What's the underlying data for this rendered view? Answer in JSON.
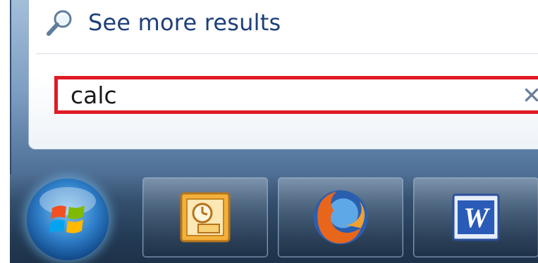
{
  "start_menu": {
    "see_more_label": "See more results",
    "search": {
      "value": "calc",
      "clear_glyph": "×",
      "highlight_color": "#e01b24"
    }
  },
  "taskbar": {
    "start_button_icon": "windows-orb-icon",
    "pinned": [
      {
        "icon": "outlook-icon"
      },
      {
        "icon": "firefox-icon"
      },
      {
        "icon": "word-icon",
        "glyph": "W"
      }
    ]
  }
}
